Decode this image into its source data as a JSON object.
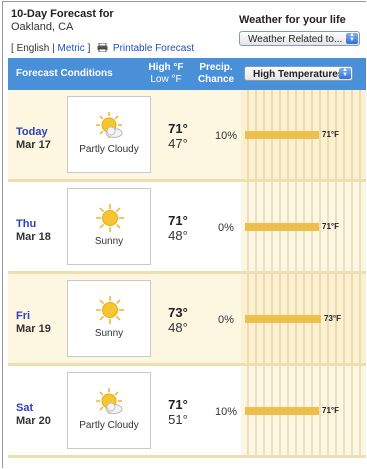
{
  "header": {
    "title": "10-Day Forecast for",
    "location": "Oakland, CA",
    "units": {
      "open_bracket": "[",
      "english": "English",
      "separator": "|",
      "metric": "Metric",
      "close_bracket": "]"
    },
    "printable": "Printable Forecast",
    "weather_for_life": "Weather for your life",
    "related_select": "Weather Related to..."
  },
  "table_header": {
    "conditions": "Forecast Conditions",
    "high": "High °F",
    "low": "Low °F",
    "precip_line1": "Precip.",
    "precip_line2": "Chance",
    "graph_select": "High Temperatures"
  },
  "days": [
    {
      "name": "Today",
      "date": "Mar 17",
      "condition": "Partly Cloudy",
      "icon": "partly-cloudy-icon",
      "high": "71°",
      "low": "47°",
      "precip": "10%",
      "bar_label": "71°F",
      "high_value": 71
    },
    {
      "name": "Thu",
      "date": "Mar 18",
      "condition": "Sunny",
      "icon": "sunny-icon",
      "high": "71°",
      "low": "48°",
      "precip": "0%",
      "bar_label": "71°F",
      "high_value": 71
    },
    {
      "name": "Fri",
      "date": "Mar 19",
      "condition": "Sunny",
      "icon": "sunny-icon",
      "high": "73°",
      "low": "48°",
      "precip": "0%",
      "bar_label": "73°F",
      "high_value": 73
    },
    {
      "name": "Sat",
      "date": "Mar 20",
      "condition": "Partly Cloudy",
      "icon": "partly-cloudy-icon",
      "high": "71°",
      "low": "51°",
      "precip": "10%",
      "bar_label": "71°F",
      "high_value": 71
    }
  ],
  "colors": {
    "header_bar": "#4a90d8",
    "temp_bar": "#ecc04a",
    "day_link": "#2a3fbf"
  }
}
